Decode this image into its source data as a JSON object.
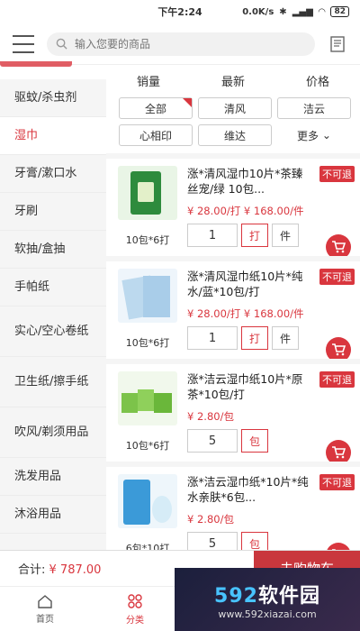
{
  "status": {
    "time": "下午2:24",
    "speed": "0.0K/s",
    "battery": "82"
  },
  "search": {
    "placeholder": "输入您要的商品"
  },
  "sidebar": {
    "items": [
      {
        "label": "驱蚊/杀虫剂"
      },
      {
        "label": "湿巾"
      },
      {
        "label": "牙膏/漱口水"
      },
      {
        "label": "牙刷"
      },
      {
        "label": "软抽/盒抽"
      },
      {
        "label": "手帕纸"
      },
      {
        "label": "实心/空心卷纸"
      },
      {
        "label": "卫生纸/擦手纸"
      },
      {
        "label": "吹风/剃须用品"
      },
      {
        "label": "洗发用品"
      },
      {
        "label": "沐浴用品"
      }
    ]
  },
  "sort": {
    "sales": "销量",
    "newest": "最新",
    "price": "价格"
  },
  "chips": [
    "全部",
    "清风",
    "洁云",
    "心相印",
    "维达",
    "更多"
  ],
  "products": [
    {
      "name": "涨*清风湿巾10片*茶臻丝宠/绿 10包...",
      "tag": "不可退",
      "price": "¥ 28.00/打  ¥ 168.00/件",
      "pack": "10包*6打",
      "qty": "1",
      "unit1": "打",
      "unit2": "件"
    },
    {
      "name": "涨*清风湿巾纸10片*纯水/蓝*10包/打",
      "tag": "不可退",
      "price": "¥ 28.00/打  ¥ 168.00/件",
      "pack": "10包*6打",
      "qty": "1",
      "unit1": "打",
      "unit2": "件"
    },
    {
      "name": "涨*洁云湿巾纸10片*原茶*10包/打",
      "tag": "不可退",
      "price": "¥ 2.80/包",
      "pack": "10包*6打",
      "qty": "5",
      "unit1": "包",
      "unit2": ""
    },
    {
      "name": "涨*洁云湿巾纸*10片*纯水亲肤*6包...",
      "tag": "不可退",
      "price": "¥ 2.80/包",
      "pack": "6包*10打",
      "qty": "5",
      "unit1": "包",
      "unit2": ""
    }
  ],
  "bottom": {
    "total_label": "合计:",
    "total_value": "¥ 787.00",
    "checkout": "去购物车"
  },
  "tabs": [
    {
      "label": "首页"
    },
    {
      "label": "分类"
    }
  ],
  "watermark": {
    "brand_num": "592",
    "brand_text": "软件园",
    "url": "www.592xiazai.com"
  },
  "colors": {
    "accent": "#d9363e"
  }
}
